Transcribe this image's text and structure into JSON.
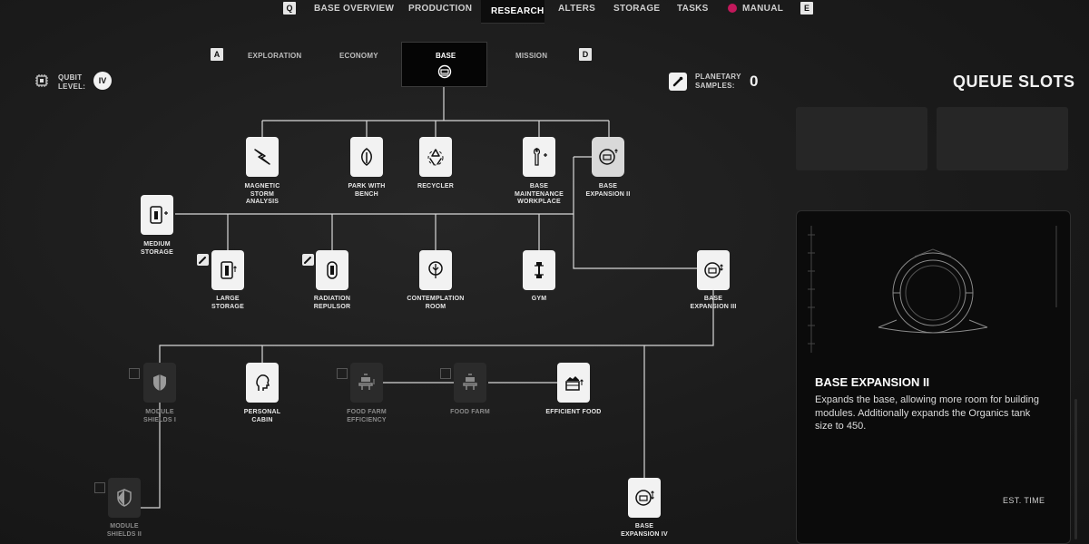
{
  "top_nav": {
    "left_key": "Q",
    "right_key": "E",
    "items": [
      "BASE OVERVIEW",
      "PRODUCTION",
      "RESEARCH",
      "ALTERS",
      "STORAGE",
      "TASKS",
      "MANUAL"
    ],
    "active": "RESEARCH"
  },
  "sub_tabs": {
    "left_key": "A",
    "right_key": "D",
    "items": [
      "EXPLORATION",
      "ECONOMY",
      "BASE",
      "MISSION"
    ],
    "active": "BASE"
  },
  "qubit": {
    "label": "QUBIT\nLEVEL:",
    "value": "IV"
  },
  "samples": {
    "label": "PLANETARY\nSAMPLES:",
    "value": "0"
  },
  "queue": {
    "title": "QUEUE SLOTS"
  },
  "nodes": {
    "magnetic_storm": "MAGNETIC\nSTORM\nANALYSIS",
    "park_bench": "PARK WITH\nBENCH",
    "recycler": "RECYCLER",
    "base_maintenance": "BASE\nMAINTENANCE\nWORKPLACE",
    "base_expansion_2": "BASE\nEXPANSION II",
    "medium_storage": "MEDIUM\nSTORAGE",
    "large_storage": "LARGE\nSTORAGE",
    "radiation_repulsor": "RADIATION\nREPULSOR",
    "contemplation_room": "CONTEMPLATION\nROOM",
    "gym": "GYM",
    "base_expansion_3": "BASE\nEXPANSION III",
    "module_shields_1": "MODULE\nSHIELDS I",
    "personal_cabin": "PERSONAL\nCABIN",
    "food_farm_efficiency": "FOOD FARM\nEFFICIENCY",
    "food_farm": "FOOD FARM",
    "efficient_food": "EFFICIENT FOOD",
    "module_shields_2": "MODULE\nSHIELDS II",
    "base_expansion_4": "BASE\nEXPANSION IV"
  },
  "info": {
    "title": "BASE EXPANSION II",
    "description": "Expands the base, allowing more room for building modules. Additionally expands the Organics tank size to 450.",
    "est_time_label": "EST. TIME"
  },
  "colors": {
    "background": "#1a1a1a",
    "node": "#f2f2f2",
    "accent": "#c2185b"
  }
}
